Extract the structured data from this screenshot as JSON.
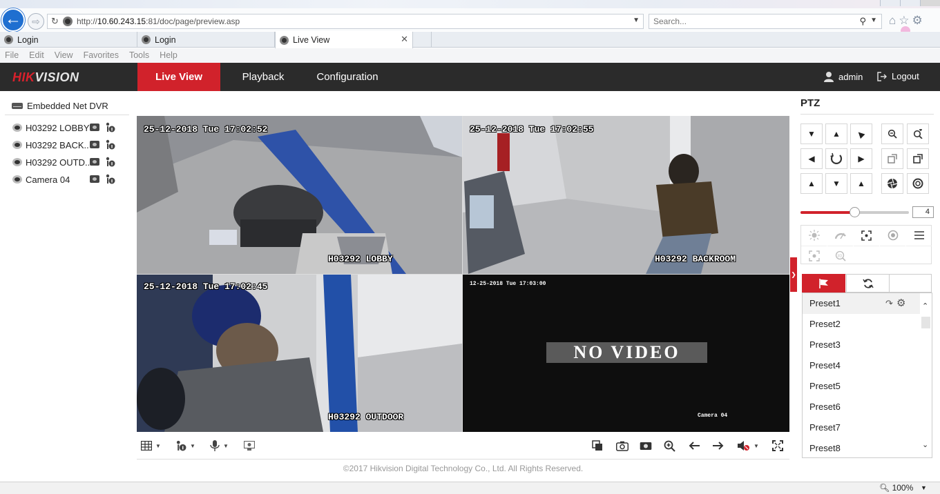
{
  "browser": {
    "url_prefix": "http://",
    "url_host": "10.60.243.15",
    "url_rest": ":81/doc/page/preview.asp",
    "search_placeholder": "Search...",
    "tabs": [
      {
        "label": "Login"
      },
      {
        "label": "Login"
      },
      {
        "label": "Live View"
      }
    ],
    "menu": [
      "File",
      "Edit",
      "View",
      "Favorites",
      "Tools",
      "Help"
    ],
    "zoom": "100%"
  },
  "app": {
    "brand_red": "HIK",
    "brand_white": "VISION",
    "nav": [
      {
        "label": "Live View",
        "active": true
      },
      {
        "label": "Playback"
      },
      {
        "label": "Configuration"
      }
    ],
    "user": "admin",
    "logout": "Logout",
    "colors": {
      "accent": "#d1222b",
      "header": "#2b2b2b"
    }
  },
  "tree": {
    "device": "Embedded Net DVR",
    "cameras": [
      {
        "label": "H03292 LOBBY"
      },
      {
        "label": "H03292 BACK..."
      },
      {
        "label": "H03292 OUTD..."
      },
      {
        "label": "Camera 04"
      }
    ]
  },
  "video": {
    "cells": [
      {
        "timestamp": "25-12-2018 Tue 17:02:52",
        "name": "H03292 LOBBY"
      },
      {
        "timestamp": "25-12-2018 Tue 17:02:55",
        "name": "H03292 BACKROOM"
      },
      {
        "timestamp": "25-12-2018 Tue 17:02:45",
        "name": "H03292 OUTDOOR"
      },
      {
        "timestamp": "12-25-2018 Tue 17:03:00",
        "name": "Camera 04",
        "overlay": "NO VIDEO"
      }
    ]
  },
  "ptz": {
    "title": "PTZ",
    "speed": "4",
    "speed_level_fraction": 0.5,
    "presets": [
      "Preset1",
      "Preset2",
      "Preset3",
      "Preset4",
      "Preset5",
      "Preset6",
      "Preset7",
      "Preset8"
    ]
  },
  "footer": {
    "copyright": "©2017 Hikvision Digital Technology Co., Ltd. All Rights Reserved."
  }
}
